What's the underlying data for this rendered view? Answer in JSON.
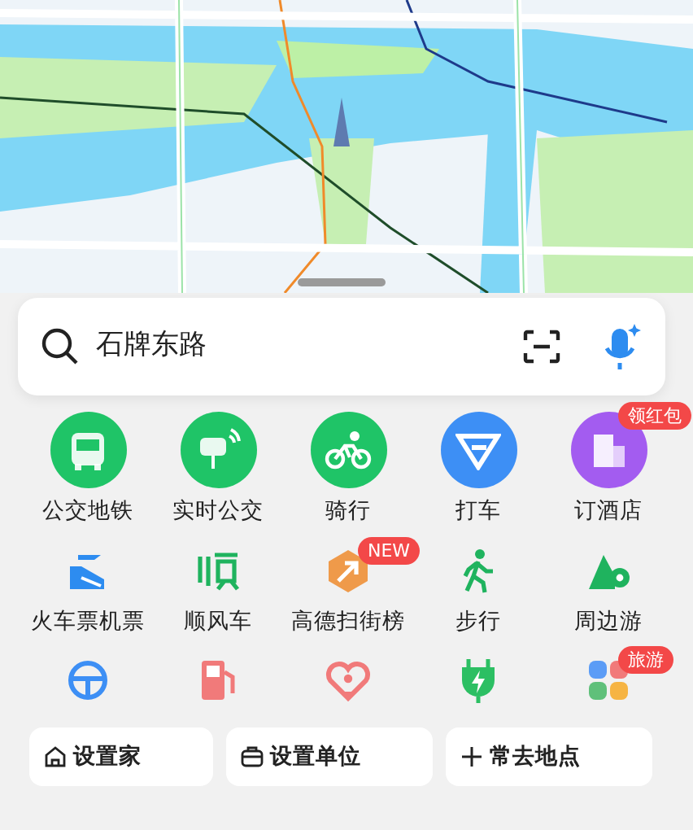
{
  "search": {
    "value": "石牌东路"
  },
  "shortcut_rows": [
    {
      "kind": "circle",
      "items": [
        {
          "label": "公交地铁",
          "color": "#1fc467"
        },
        {
          "label": "实时公交",
          "color": "#1fc467"
        },
        {
          "label": "骑行",
          "color": "#1fc467"
        },
        {
          "label": "打车",
          "color": "#3d8ff5"
        },
        {
          "label": "订酒店",
          "color": "#a35cf0",
          "badge": "领红包"
        }
      ]
    },
    {
      "kind": "plain",
      "items": [
        {
          "label": "火车票机票"
        },
        {
          "label": "顺风车"
        },
        {
          "label": "高德扫街榜",
          "badge": "NEW"
        },
        {
          "label": "步行"
        },
        {
          "label": "周边游"
        }
      ]
    },
    {
      "kind": "plain",
      "items": [
        {
          "kind": "shortcut"
        },
        {
          "kind": "shortcut"
        },
        {
          "kind": "shortcut"
        },
        {
          "kind": "shortcut"
        },
        {
          "kind": "shortcut",
          "badge": "旅游"
        }
      ]
    }
  ],
  "quick_places": [
    {
      "kind": "home",
      "label": "设置家"
    },
    {
      "kind": "work",
      "label": "设置单位"
    },
    {
      "kind": "add",
      "label": "常去地点"
    }
  ]
}
